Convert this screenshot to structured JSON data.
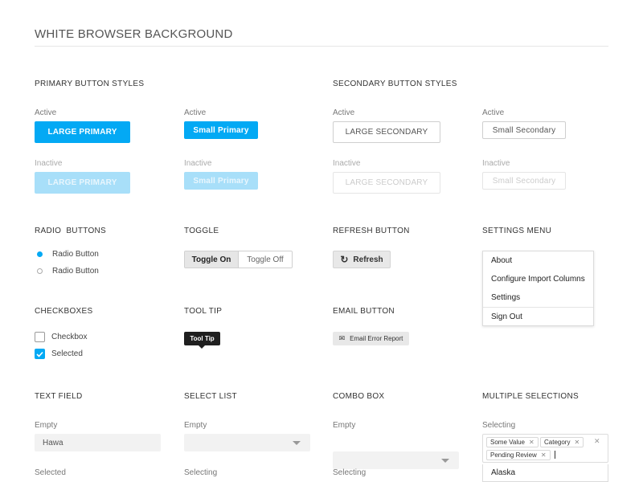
{
  "page": {
    "title": "WHITE BROWSER BACKGROUND"
  },
  "primary": {
    "title": "PRIMARY BUTTON STYLES",
    "active_label": "Active",
    "inactive_label": "Inactive",
    "large": "LARGE PRIMARY",
    "small": "Small Primary"
  },
  "secondary": {
    "title": "SECONDARY BUTTON STYLES",
    "active_label": "Active",
    "inactive_label": "Inactive",
    "large": "LARGE SECONDARY",
    "small": "Small Secondary"
  },
  "radio": {
    "title": "RADIO  BUTTONS",
    "items": [
      {
        "label": "Radio Button",
        "selected": true
      },
      {
        "label": "Radio Button",
        "selected": false
      }
    ]
  },
  "toggle": {
    "title": "TOGGLE",
    "on_label": "Toggle On",
    "off_label": "Toggle Off"
  },
  "refresh": {
    "title": "REFRESH BUTTON",
    "label": "Refresh",
    "icon": "refresh-icon"
  },
  "settings": {
    "title": "SETTINGS MENU",
    "items": [
      "About",
      "Configure Import Columns",
      "Settings",
      "Sign Out"
    ]
  },
  "checkboxes": {
    "title": "CHECKBOXES",
    "items": [
      {
        "label": "Checkbox",
        "checked": false
      },
      {
        "label": "Selected",
        "checked": true
      }
    ]
  },
  "tooltip": {
    "title": "TOOL TIP",
    "text": "Tool Tip"
  },
  "email": {
    "title": "EMAIL BUTTON",
    "label": "Email Error Report",
    "icon": "envelope-icon"
  },
  "text_field": {
    "title": "TEXT FIELD",
    "empty_label": "Empty",
    "value": "Hawa",
    "selected_label": "Selected"
  },
  "select_list": {
    "title": "SELECT LIST",
    "empty_label": "Empty",
    "selecting_label": "Selecting"
  },
  "combo_box": {
    "title": "COMBO BOX",
    "empty_label": "Empty",
    "selecting_label": "Selecting"
  },
  "multi": {
    "title": "MULTIPLE SELECTIONS",
    "selecting_label": "Selecting",
    "chips": [
      "Some Value",
      "Category",
      "Pending Review"
    ],
    "option": "Alaska"
  },
  "colors": {
    "accent": "#03a9f4",
    "accent_inactive": "#a8dff9",
    "tooltip_bg": "#1f1f1f"
  }
}
